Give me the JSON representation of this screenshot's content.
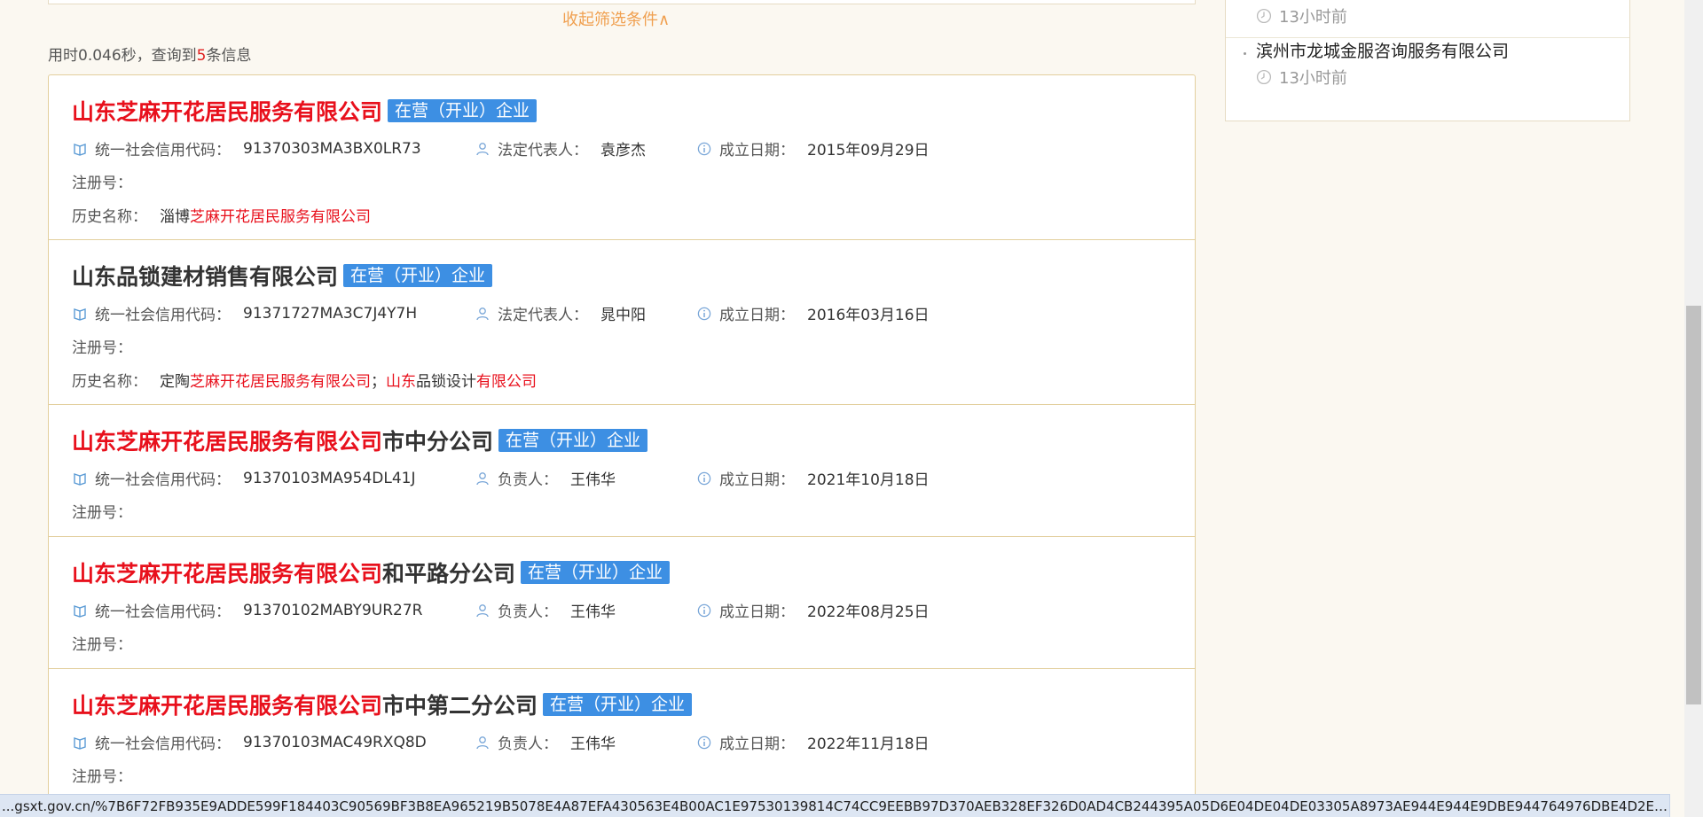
{
  "filter": {
    "collapse_label": "收起筛选条件∧"
  },
  "query": {
    "prefix": "用时0.046秒，查询到",
    "count": "5",
    "suffix": "条信息"
  },
  "labels": {
    "credit_code": "统一社会信用代码：",
    "established": "成立日期：",
    "reg_no": "注册号：",
    "history": "历史名称："
  },
  "results": [
    {
      "name_hl": "山东芝麻开花居民服务有限公司",
      "name_rest": "",
      "status": "在营（开业）企业",
      "credit_code": "91370303MA3BX0LR73",
      "person_label": "法定代表人：",
      "person": "袁彦杰",
      "established": "2015年09月29日",
      "history": {
        "p1": "淄博",
        "h1": "芝麻开花居民服务有限公司",
        "p2": "",
        "h2": "",
        "p3": "",
        "h3": ""
      }
    },
    {
      "name_hl": "",
      "name_rest": "山东品锁建材销售有限公司",
      "status": "在营（开业）企业",
      "credit_code": "91371727MA3C7J4Y7H",
      "person_label": "法定代表人：",
      "person": "晁中阳",
      "established": "2016年03月16日",
      "history": {
        "p1": "定陶",
        "h1": "芝麻开花居民服务有限公司",
        "p2": "；",
        "h2": "山东",
        "p3": "品锁设计",
        "h3": "有限公司"
      }
    },
    {
      "name_hl": "山东芝麻开花居民服务有限公司",
      "name_rest": "市中分公司",
      "status": "在营（开业）企业",
      "credit_code": "91370103MA954DL41J",
      "person_label": "负责人：",
      "person": "王伟华",
      "established": "2021年10月18日"
    },
    {
      "name_hl": "山东芝麻开花居民服务有限公司",
      "name_rest": "和平路分公司",
      "status": "在营（开业）企业",
      "credit_code": "91370102MABY9UR27R",
      "person_label": "负责人：",
      "person": "王伟华",
      "established": "2022年08月25日"
    },
    {
      "name_hl": "山东芝麻开花居民服务有限公司",
      "name_rest": "市中第二分公司",
      "status": "在营（开业）企业",
      "credit_code": "91370103MAC49RXQ8D",
      "person_label": "负责人：",
      "person": "王伟华",
      "established": "2022年11月18日"
    }
  ],
  "sidebar": {
    "items": [
      {
        "title": "",
        "time": "13小时前"
      },
      {
        "title": "滨州市龙城金服咨询服务有限公司",
        "time": "13小时前"
      }
    ]
  },
  "status_bar": {
    "url": "...gsxt.gov.cn/%7B6F72FB935E9ADDE599F184403C90569BF3B8EA965219B5078E4A87EFA430563E4B00AC1E97530139814C74CC9EEBB97D370AEB328EF326D0AD4CB244395A05D6E04DE04DE03305A8973AE944E944E9DBE944764976DBE4D2E4AB605639112AE..."
  },
  "colors": {
    "highlight": "#e8101c",
    "badge": "#3d8fe3",
    "border": "#e3cf9e",
    "link": "#f0a050"
  },
  "icons": [
    "book-icon",
    "person-icon",
    "info-icon",
    "clock-icon"
  ]
}
